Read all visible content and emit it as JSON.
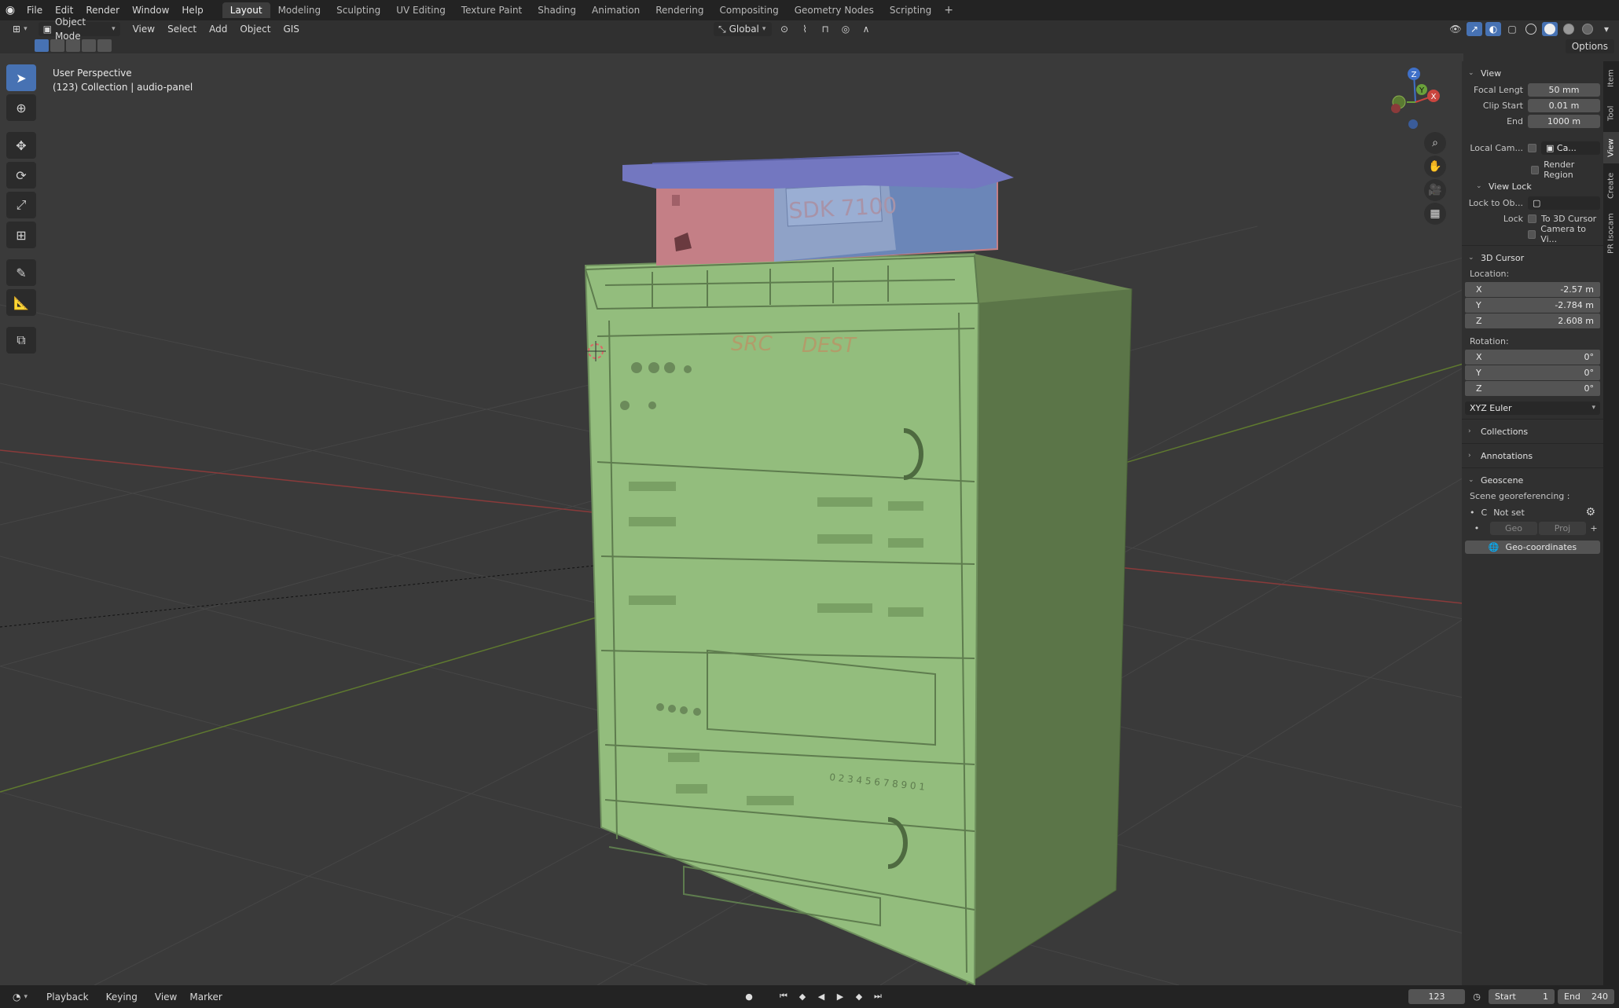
{
  "topbar": {
    "menus": [
      "File",
      "Edit",
      "Render",
      "Window",
      "Help"
    ],
    "workspaces": [
      "Layout",
      "Modeling",
      "Sculpting",
      "UV Editing",
      "Texture Paint",
      "Shading",
      "Animation",
      "Rendering",
      "Compositing",
      "Geometry Nodes",
      "Scripting"
    ],
    "active_workspace": "Layout",
    "add": "+"
  },
  "header": {
    "mode": "Object Mode",
    "menus": [
      "View",
      "Select",
      "Add",
      "Object",
      "GIS"
    ],
    "orientation": "Global"
  },
  "subheader": {
    "options": "Options"
  },
  "viewport": {
    "perspective": "User Perspective",
    "collection": "(123) Collection | audio-panel",
    "model_text": {
      "device": "SDK 7100",
      "src": "SRC",
      "dest": "DEST",
      "digits": "0 2  3 4 5  6 7 8  9 0 1"
    },
    "gizmo": {
      "z": "Z",
      "y": "Y",
      "x": "X"
    }
  },
  "npanel": {
    "view": {
      "title": "View",
      "focal_label": "Focal Lengt",
      "focal_value": "50 mm",
      "clip_start_label": "Clip Start",
      "clip_start_value": "0.01 m",
      "end_label": "End",
      "end_value": "1000 m",
      "local_cam_label": "Local Cam...",
      "local_cam_value": "Ca...",
      "render_region": "Render Region"
    },
    "view_lock": {
      "title": "View Lock",
      "lock_to_ob": "Lock to Ob...",
      "lock_label": "Lock",
      "to_3d_cursor": "To 3D Cursor",
      "camera_to_view": "Camera to Vi..."
    },
    "cursor": {
      "title": "3D Cursor",
      "location": "Location:",
      "x": "-2.57 m",
      "y": "-2.784 m",
      "z": "2.608 m",
      "rotation": "Rotation:",
      "rx": "0°",
      "ry": "0°",
      "rz": "0°",
      "rotation_mode": "XYZ Euler",
      "axis_x": "X",
      "axis_y": "Y",
      "axis_z": "Z"
    },
    "collections": "Collections",
    "annotations": "Annotations",
    "geoscene": {
      "title": "Geoscene",
      "georef": "Scene georeferencing :",
      "crs_prefix": "C",
      "crs": "Not set",
      "geo": "Geo",
      "proj": "Proj",
      "geo_coords": "Geo-coordinates"
    }
  },
  "vtabs": [
    "Item",
    "Tool",
    "View",
    "Create",
    "PR Isocam"
  ],
  "timeline": {
    "menus": [
      "Playback",
      "Keying",
      "View",
      "Marker"
    ],
    "current_frame": "123",
    "start_label": "Start",
    "start": "1",
    "end_label": "End",
    "end": "240"
  }
}
